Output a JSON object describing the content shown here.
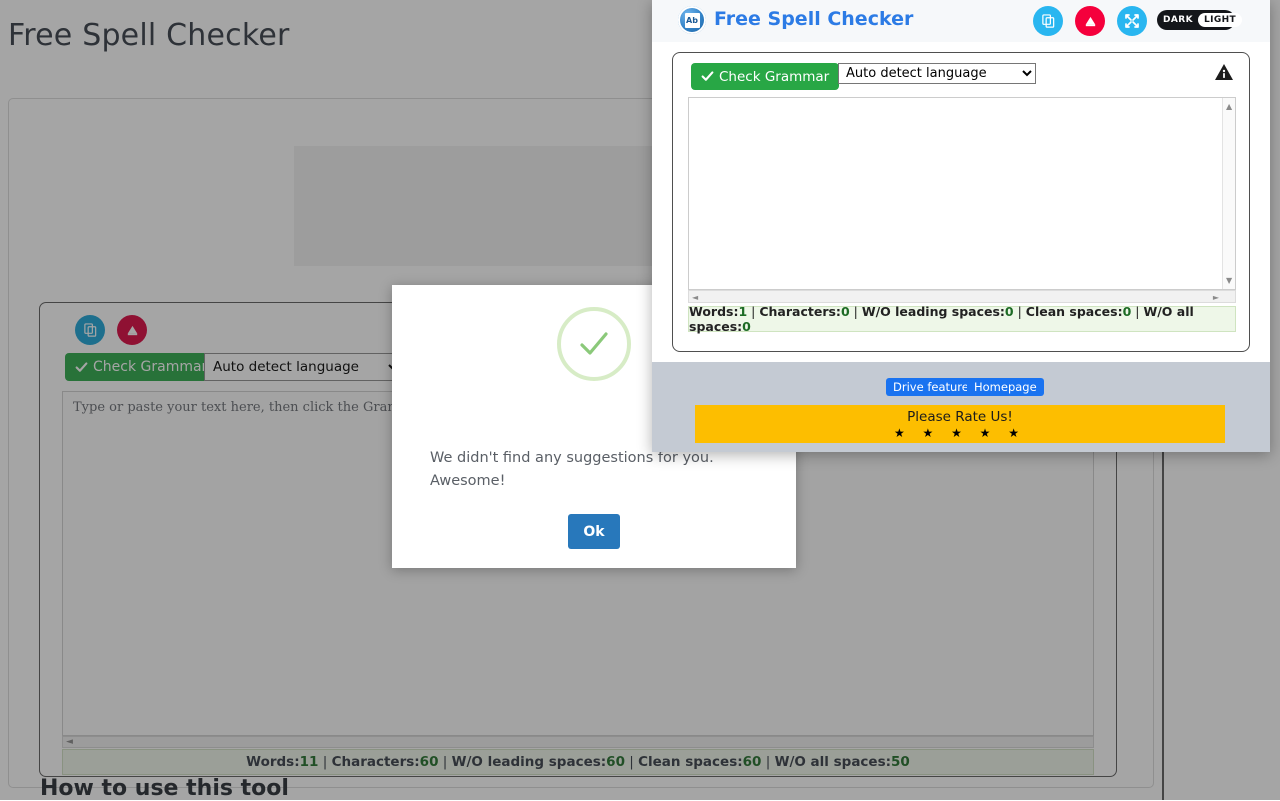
{
  "background_page": {
    "title": "Free Spell Checker",
    "copy_icon": "copy-icon",
    "erase_icon": "eraser-icon",
    "check_grammar_label": "Check Grammar",
    "language_selected": "Auto detect language",
    "language_options": [
      "Auto detect language"
    ],
    "textarea_placeholder": "Type or paste your text here, then click the Grammar button.",
    "textarea_value": "",
    "status": {
      "words_label": "Words:",
      "words_value": "11",
      "characters_label": "Characters:",
      "characters_value": "60",
      "wo_leading_label": "W/O leading spaces:",
      "wo_leading_value": "60",
      "clean_label": "Clean spaces:",
      "clean_value": "60",
      "wo_all_label": "W/O all spaces:",
      "wo_all_value": "50",
      "separator": " | "
    },
    "howto_heading": "How to use this tool"
  },
  "modal": {
    "icon": "success-check-icon",
    "message": "We didn't find any suggestions for you. Awesome!",
    "ok_label": "Ok"
  },
  "popup": {
    "logo_text": "Ab",
    "title": "Free Spell Checker",
    "toolbar": {
      "copy_icon": "copy-icon",
      "erase_icon": "eraser-icon",
      "expand_icon": "expand-icon",
      "theme_dark_label": "DARK",
      "theme_light_label": "LIGHT",
      "theme_selected": "LIGHT"
    },
    "check_grammar_label": "Check Grammar",
    "language_selected": "Auto detect language",
    "language_options": [
      "Auto detect language"
    ],
    "info_icon": "info-warning-icon",
    "textarea_value": "",
    "status": {
      "words_label": "Words:",
      "words_value": "1",
      "characters_label": "Characters:",
      "characters_value": "0",
      "wo_leading_label": "W/O leading spaces:",
      "wo_leading_value": "0",
      "clean_label": "Clean spaces:",
      "clean_value": "0",
      "wo_all_label": "W/O all spaces:",
      "wo_all_value": "0",
      "separator": " | "
    },
    "footer": {
      "drive_feature_label": "Drive feature",
      "homepage_label": "Homepage",
      "rate_label": "Please Rate Us!",
      "stars": "★ ★ ★ ★ ★"
    }
  },
  "colors": {
    "accent_blue": "#2c7be5",
    "green": "#28a745",
    "red": "#f5003c",
    "cyan": "#29b6f0",
    "amber": "#fdbe00"
  }
}
